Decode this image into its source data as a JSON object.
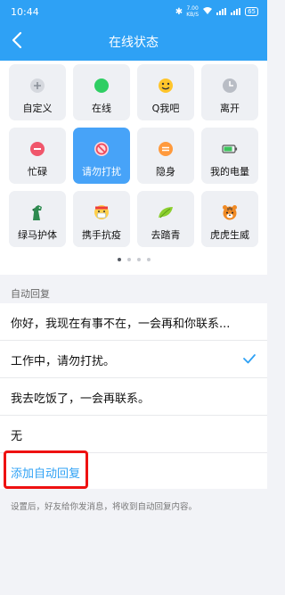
{
  "status_bar": {
    "time": "10:44",
    "speed_top": "7.00",
    "speed_bottom": "KB/S",
    "battery": "65"
  },
  "nav": {
    "title": "在线状态"
  },
  "status_tiles": [
    {
      "label": "自定义",
      "icon": "plus-icon"
    },
    {
      "label": "在线",
      "icon": "green-dot-icon"
    },
    {
      "label": "Q我吧",
      "icon": "smiley-icon"
    },
    {
      "label": "离开",
      "icon": "clock-icon"
    },
    {
      "label": "忙碌",
      "icon": "minus-icon"
    },
    {
      "label": "请勿打扰",
      "icon": "do-not-disturb-icon",
      "selected": true
    },
    {
      "label": "隐身",
      "icon": "hidden-icon"
    },
    {
      "label": "我的电量",
      "icon": "battery-icon"
    },
    {
      "label": "绿马护体",
      "icon": "green-horse-icon"
    },
    {
      "label": "携手抗疫",
      "icon": "mask-face-icon"
    },
    {
      "label": "去踏青",
      "icon": "leaf-icon"
    },
    {
      "label": "虎虎生威",
      "icon": "tiger-icon"
    }
  ],
  "auto_reply": {
    "section_label": "自动回复",
    "items": [
      {
        "text": "你好，我现在有事不在，一会再和你联系..."
      },
      {
        "text": "工作中，请勿打扰。",
        "selected": true
      },
      {
        "text": "我去吃饭了，一会再联系。"
      },
      {
        "text": "无"
      }
    ],
    "add_label": "添加自动回复",
    "hint": "设置后，好友给你发消息，将收到自动回复内容。"
  },
  "colors": {
    "accent": "#2ea1f5",
    "selected_tile": "#47a3f8",
    "highlight_box": "#ee1111"
  }
}
